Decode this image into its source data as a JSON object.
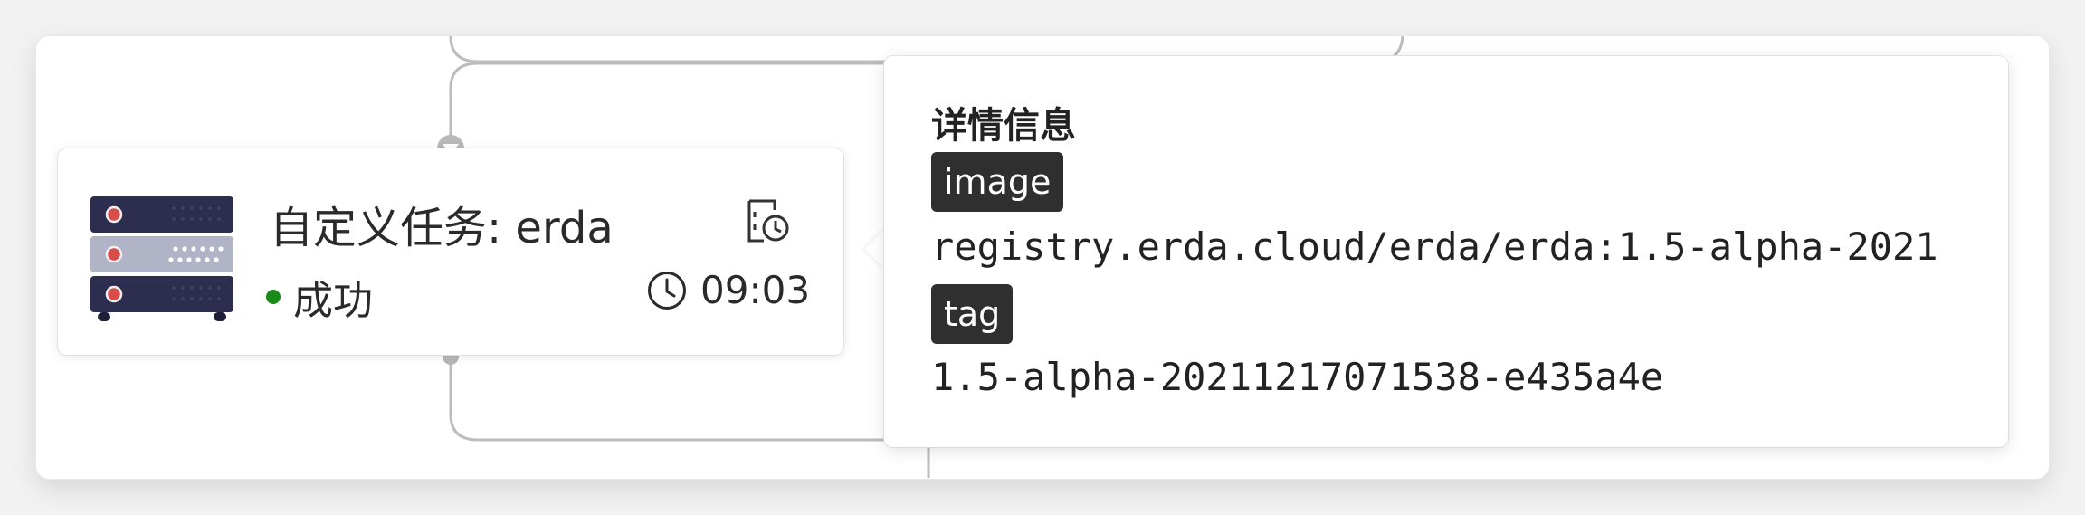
{
  "pipeline_node": {
    "title": "自定义任务: erda",
    "status": "成功",
    "status_color": "#1a8a1a",
    "time": "09:03",
    "icon": "server-rack-icon",
    "history_icon": "run-history-icon"
  },
  "details_popover": {
    "title": "详情信息",
    "fields": [
      {
        "key": "image",
        "value": "registry.erda.cloud/erda/erda:1.5-alpha-2021"
      },
      {
        "key": "tag",
        "value": "1.5-alpha-20211217071538-e435a4e"
      }
    ]
  }
}
